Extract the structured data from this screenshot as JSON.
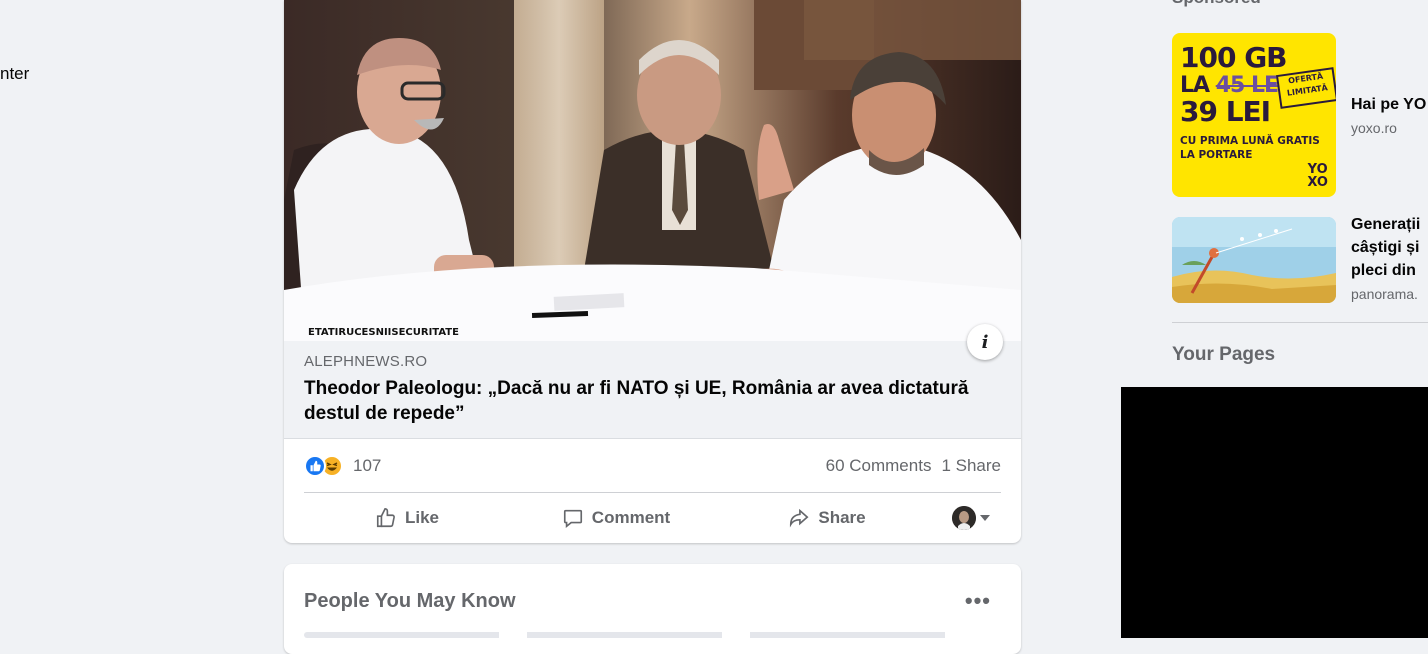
{
  "left_nav": {
    "fragment_text": "nter"
  },
  "post": {
    "image_watermark": "ETATIRUCESNIISECURITATE",
    "link": {
      "domain": "ALEPHNEWS.RO",
      "title": "Theodor Paleologu: „Dacă nu ar fi NATO și UE, România ar avea dictatură destul de repede”"
    },
    "info_icon_glyph": "i",
    "reactions": {
      "types": [
        "like",
        "haha"
      ],
      "count": "107"
    },
    "comments": "60 Comments",
    "shares": "1 Share",
    "actions": {
      "like": "Like",
      "comment": "Comment",
      "share": "Share"
    }
  },
  "pymk": {
    "title": "People You May Know",
    "more": "•••"
  },
  "sidebar": {
    "sponsored_heading": "Sponsored",
    "ads": [
      {
        "title": "Hai pe YO",
        "domain": "yoxo.ro",
        "creative": {
          "line1": "100 GB",
          "line2_prefix": "LA ",
          "line2_strike": "45 LEI",
          "line3": "39 LEI",
          "badge": "OFERTĂ LIMITATĂ",
          "line4": "CU PRIMA LUNĂ GRATIS",
          "line5": "LA PORTARE",
          "logo_top": "YO",
          "logo_bottom": "XO"
        }
      },
      {
        "title_lines": [
          "Generații",
          "câștigi și",
          "pleci din"
        ],
        "domain": "panorama."
      }
    ],
    "your_pages": "Your Pages"
  },
  "colors": {
    "background": "#f0f2f5",
    "card": "#ffffff",
    "secondary_text": "#65676b",
    "like_blue": "#1877f2",
    "haha_yellow": "#f7b125",
    "yoxo_yellow": "#ffe500"
  }
}
